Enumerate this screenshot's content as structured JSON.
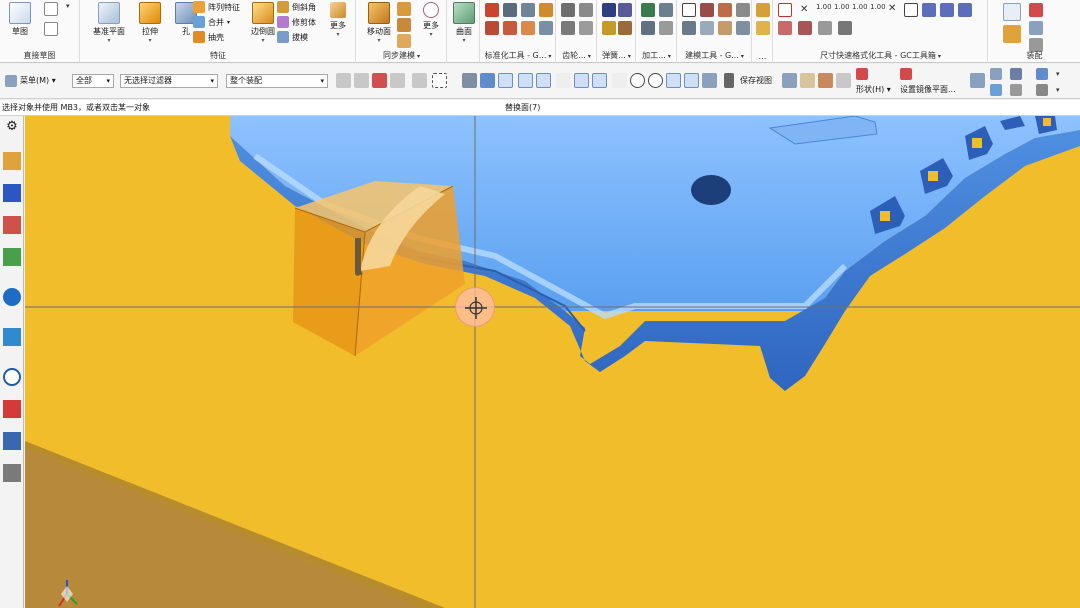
{
  "ribbon": {
    "groups": {
      "direct_sketch": "直接草图",
      "feature": "特征",
      "sync_modeling": "同步建模",
      "standard_tools": "标准化工具 - G...",
      "gear": "齿轮...",
      "spring": "弹簧...",
      "machining": "加工...",
      "modeling_tools": "建模工具 - G...",
      "more": "…",
      "dimension_tools": "尺寸快速格式化工具 - GC工具箱",
      "assembly": "装配"
    },
    "buttons": {
      "sketch": "草图",
      "datum_plane": "基准平面",
      "extrude": "拉伸",
      "hole": "孔",
      "pattern_feature": "阵列特征",
      "unite": "合并",
      "shell": "抽壳",
      "edge_blend": "边倒圆",
      "chamfer": "倒斜角",
      "trim_body": "修剪体",
      "draft": "拔模",
      "more_feature": "更多",
      "move_face": "移动面",
      "more_sync": "更多",
      "surface": "曲面"
    }
  },
  "toolbar": {
    "menu_label": "菜单(M)",
    "type_filter": "全部",
    "selection_filter": "无选择过滤器",
    "scope": "整个装配",
    "save_view": "保存视图",
    "shape": "形状(H)",
    "set_mirror_plane": "设置镜像平面..."
  },
  "status": {
    "prompt": "选择对象并使用 MB3，或者双击某一对象",
    "selection": "替换面(7)"
  },
  "dim_icons": [
    "1.00",
    "1.00",
    "1.00",
    "1.00"
  ],
  "colors": {
    "background": "#f2bd2a",
    "part_blue": "#4f9bf2",
    "transparent_block": "#f0a020",
    "floor_plane": "#b7893a"
  }
}
